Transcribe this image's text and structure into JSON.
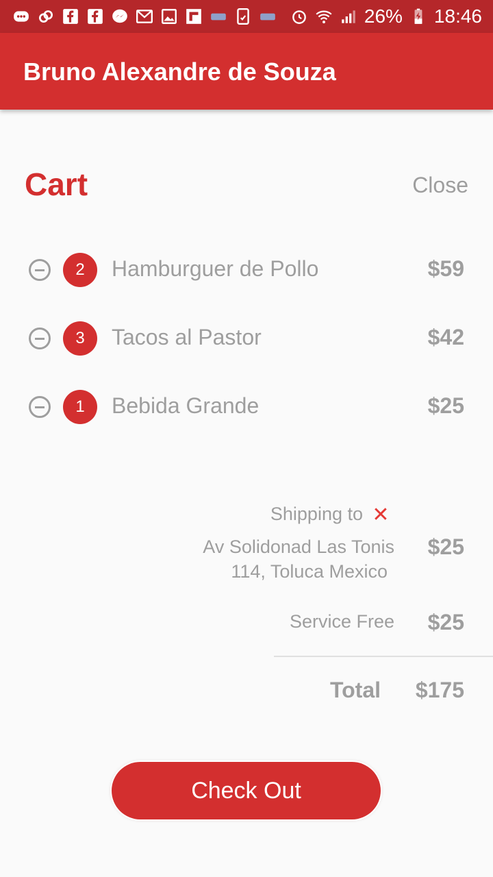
{
  "status_bar": {
    "icons_left": [
      "chat-bubble-icon",
      "link-icon",
      "facebook-icon",
      "facebook-icon",
      "messenger-icon",
      "gmail-icon",
      "gallery-icon",
      "flipboard-icon",
      "news-icon",
      "tablet-icon",
      "news-icon"
    ],
    "battery": "26%",
    "time": "18:46"
  },
  "app_bar": {
    "title": "Bruno Alexandre de Souza",
    "color": "#d32f2f"
  },
  "cart": {
    "title": "Cart",
    "close_label": "Close",
    "items": [
      {
        "quantity": "2",
        "name": "Hamburguer de Pollo",
        "price": "$59"
      },
      {
        "quantity": "3",
        "name": "Tacos al Pastor",
        "price": "$42"
      },
      {
        "quantity": "1",
        "name": "Bebida Grande",
        "price": "$25"
      }
    ]
  },
  "shipping": {
    "label": "Shipping to",
    "remove_icon": "close-icon",
    "address_line1": "Av Solidonad Las Tonis",
    "address_line2": "114, Toluca Mexico",
    "price": "$25"
  },
  "service": {
    "label": "Service Free",
    "price": "$25"
  },
  "total": {
    "label": "Total",
    "value": "$175"
  },
  "checkout": {
    "label": "Check Out"
  },
  "colors": {
    "accent": "#d32f2f",
    "status_bar": "#b5272a",
    "text_muted": "#9e9e9e",
    "remove": "#e53935"
  }
}
